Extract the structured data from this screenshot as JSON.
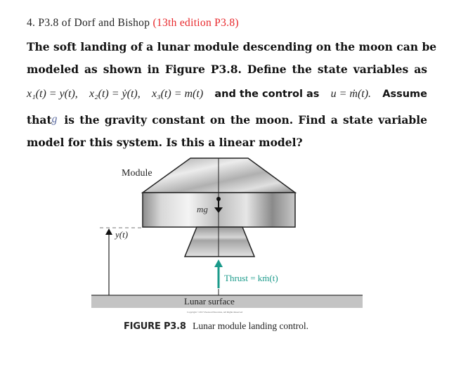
{
  "problem": {
    "number_label": "4. P3.8 of Dorf and Bishop",
    "edition_note": "(13th edition P3.8)",
    "accent_color": "#e8262a",
    "lines": {
      "line1": "The soft landing of a lunar module descending on the moon can be",
      "line2": "modeled as shown in Figure P3.8. Define the state variables as",
      "line3_math1": "x₁(t) = y(t),",
      "line3_math2": "x₂(t) = ẏ(t),",
      "line3_math3": "x₃(t) = m(t)",
      "line3_text": "and the control as",
      "line3_math4": "u = ṁ(t).",
      "line3_end": "Assume",
      "line4_start": "that",
      "line4_var": "g",
      "line4_rest": "is the gravity constant on the moon. Find a state variable",
      "line5": "model for this system. Is this a linear model?"
    }
  },
  "figure": {
    "module_label": "Module",
    "weight_label": "mg",
    "height_label": "y(t)",
    "thrust_label": "Thrust = kṁ(t)",
    "thrust_color": "#1a9a8a",
    "surface_label": "Lunar surface",
    "copyright": "Copyright ©2017 Pearson Education, All Rights Reserved",
    "caption_id": "FIGURE P3.8",
    "caption_text": "Lunar module landing control."
  }
}
